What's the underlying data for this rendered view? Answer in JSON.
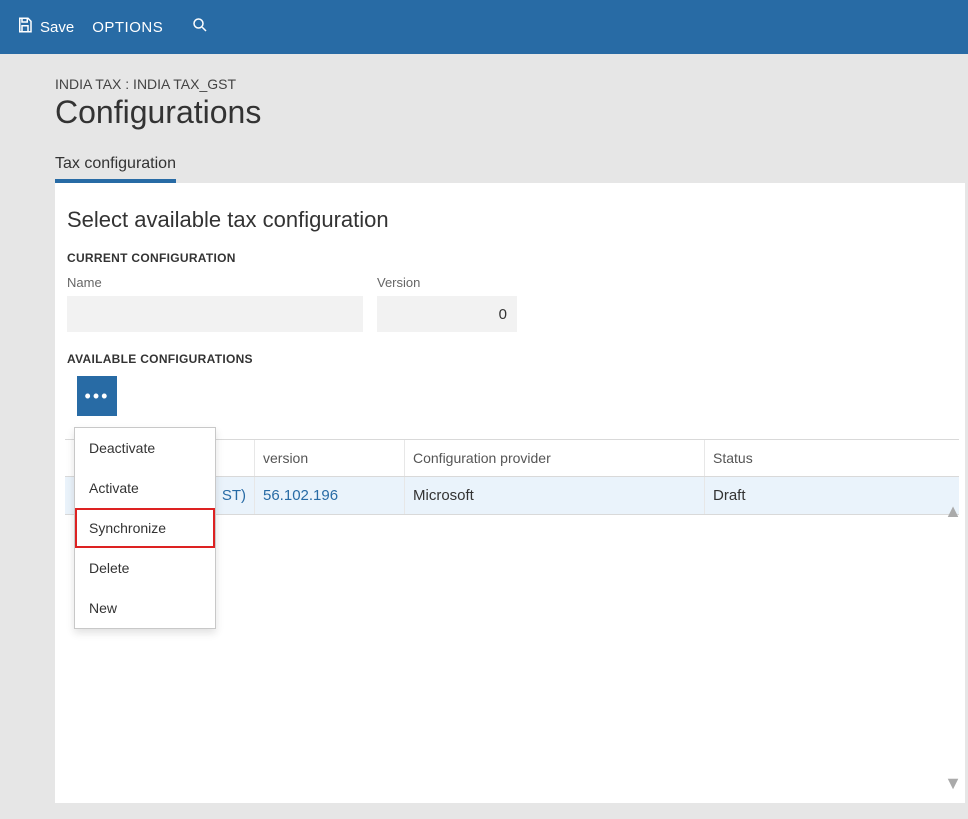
{
  "cmdbar": {
    "save_label": "Save",
    "options_label": "OPTIONS"
  },
  "breadcrumb": "INDIA TAX : INDIA TAX_GST",
  "page_title": "Configurations",
  "tabs": {
    "active_label": "Tax configuration"
  },
  "section_title": "Select available tax configuration",
  "current_config": {
    "header": "CURRENT CONFIGURATION",
    "name_label": "Name",
    "name_value": "",
    "version_label": "Version",
    "version_value": "0"
  },
  "avail": {
    "header": "AVAILABLE CONFIGURATIONS",
    "columns": {
      "version": "version",
      "provider": "Configuration provider",
      "status": "Status"
    },
    "row": {
      "name_suffix": "ST)",
      "version": "56.102.196",
      "provider": "Microsoft",
      "status": "Draft"
    }
  },
  "menu": {
    "deactivate": "Deactivate",
    "activate": "Activate",
    "synchronize": "Synchronize",
    "delete": "Delete",
    "new": "New"
  }
}
